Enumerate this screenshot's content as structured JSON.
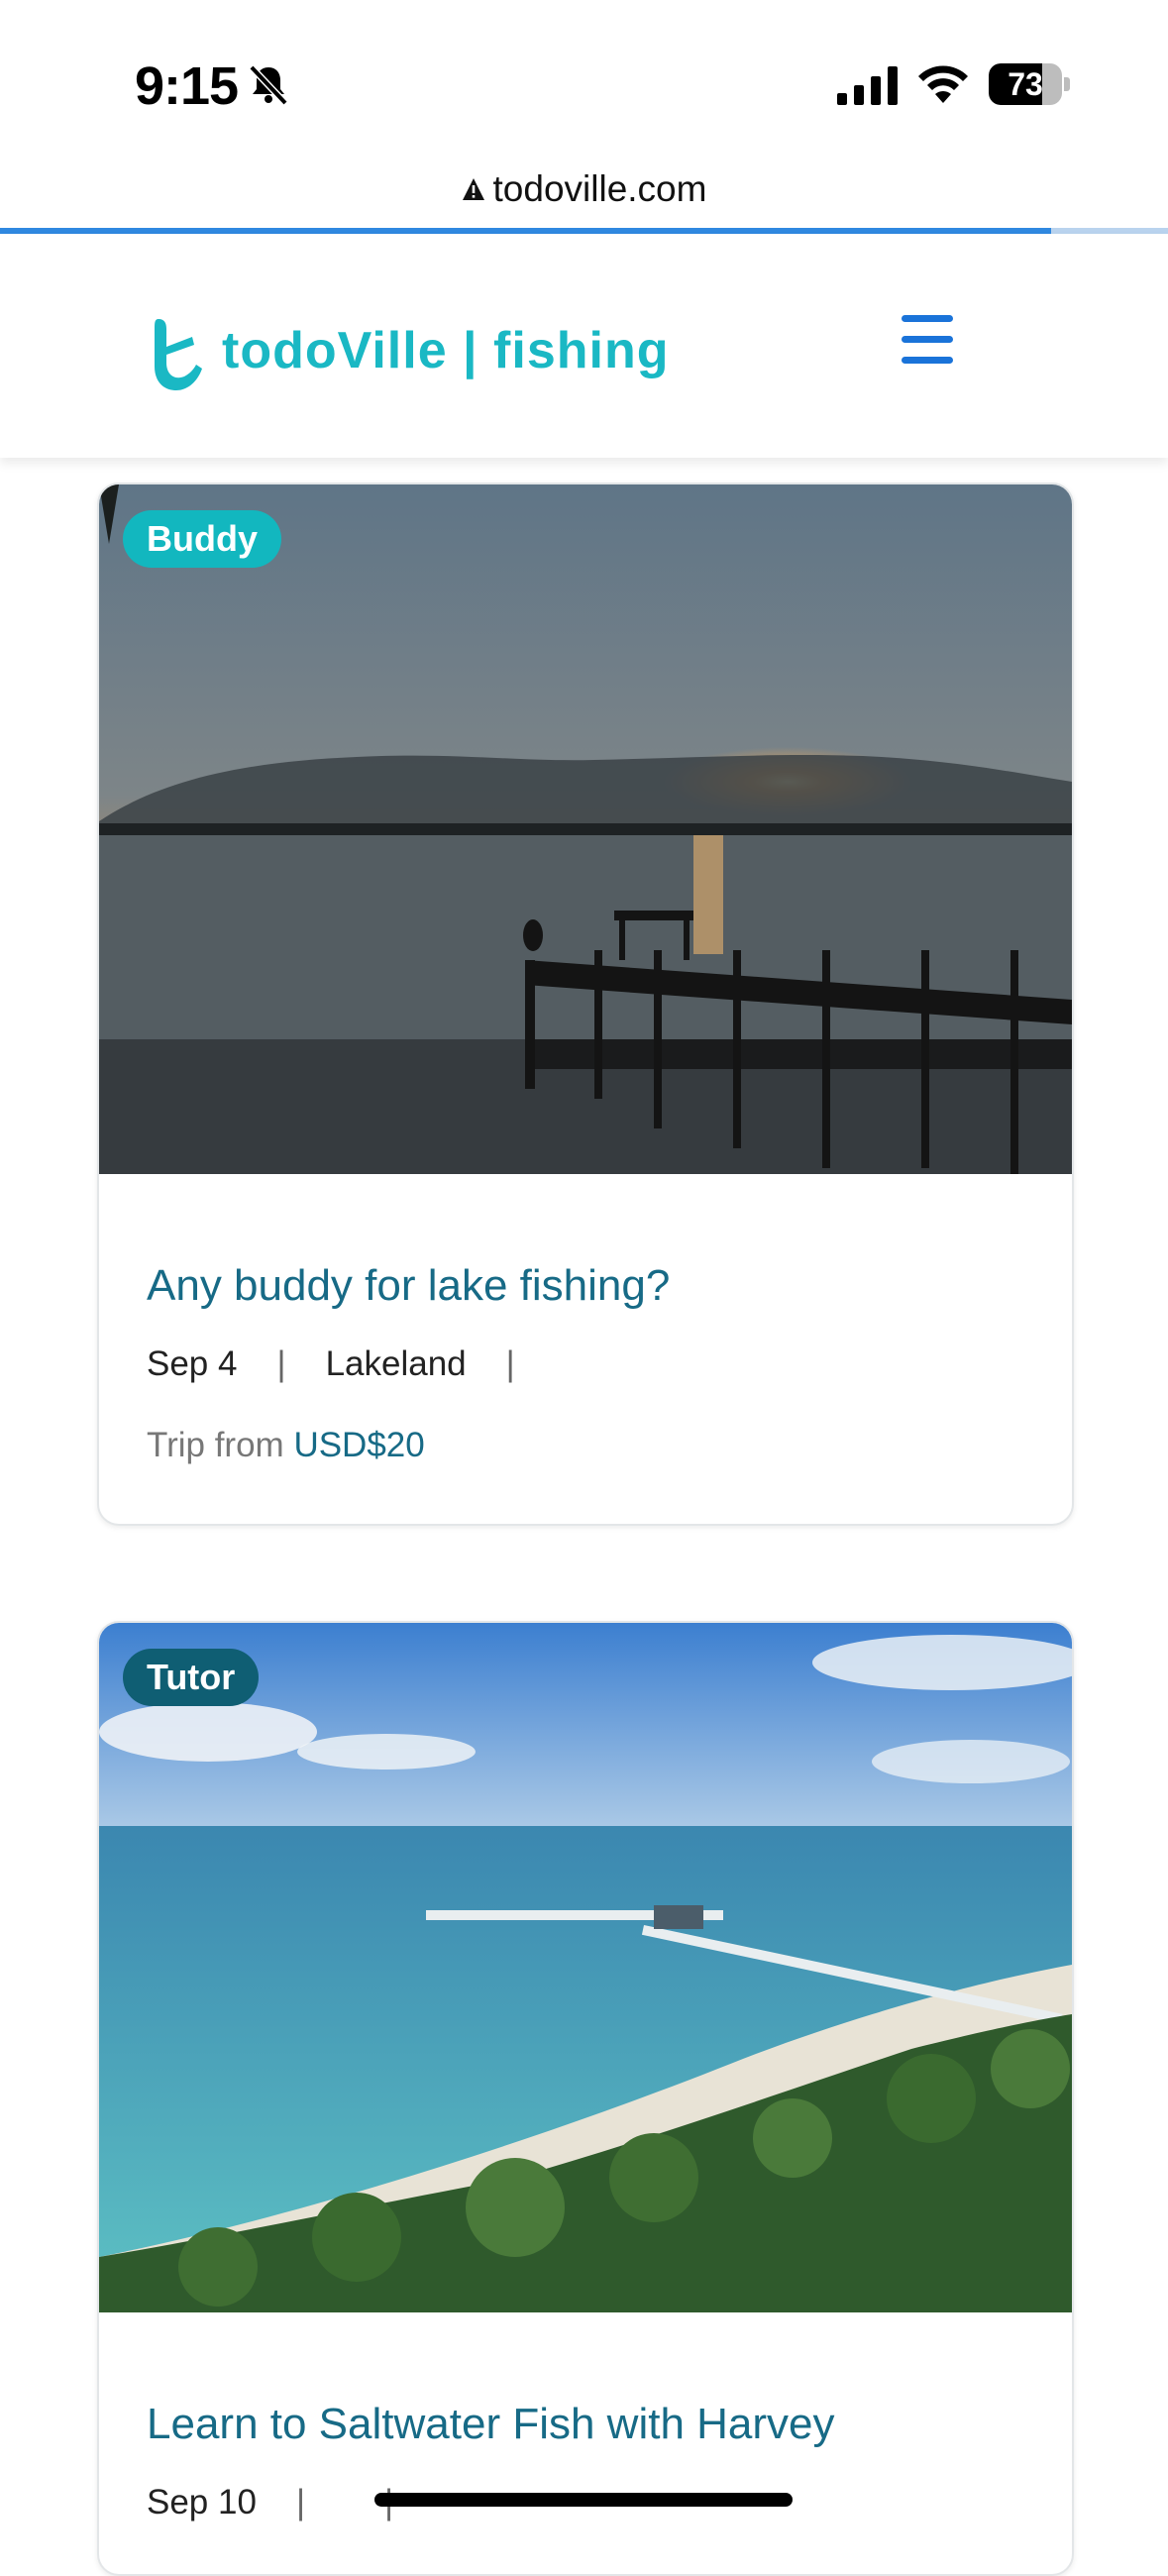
{
  "status_bar": {
    "time": "9:15",
    "battery": "73",
    "battery_level": 0.73,
    "icons": [
      "bell-slash-icon",
      "cellular-signal-icon",
      "wifi-icon",
      "battery-icon"
    ]
  },
  "browser": {
    "url": "todoville.com",
    "load_progress": 0.9
  },
  "header": {
    "logo_text": "todoVille | fishing",
    "brand_color": "#1ab8c4",
    "menu_icon": "hamburger-menu-icon",
    "menu_color": "#1a73d9"
  },
  "cards": [
    {
      "badge": "Buddy",
      "badge_color": "#12b7bf",
      "title": "Any buddy for lake fishing?",
      "date": "Sep 4",
      "location": "Lakeland",
      "price_prefix": "Trip from",
      "price": "USD$20"
    },
    {
      "badge": "Tutor",
      "badge_color": "#0f5e73",
      "title": "Learn to Saltwater Fish with Harvey",
      "date": "Sep 10",
      "location": ""
    }
  ]
}
